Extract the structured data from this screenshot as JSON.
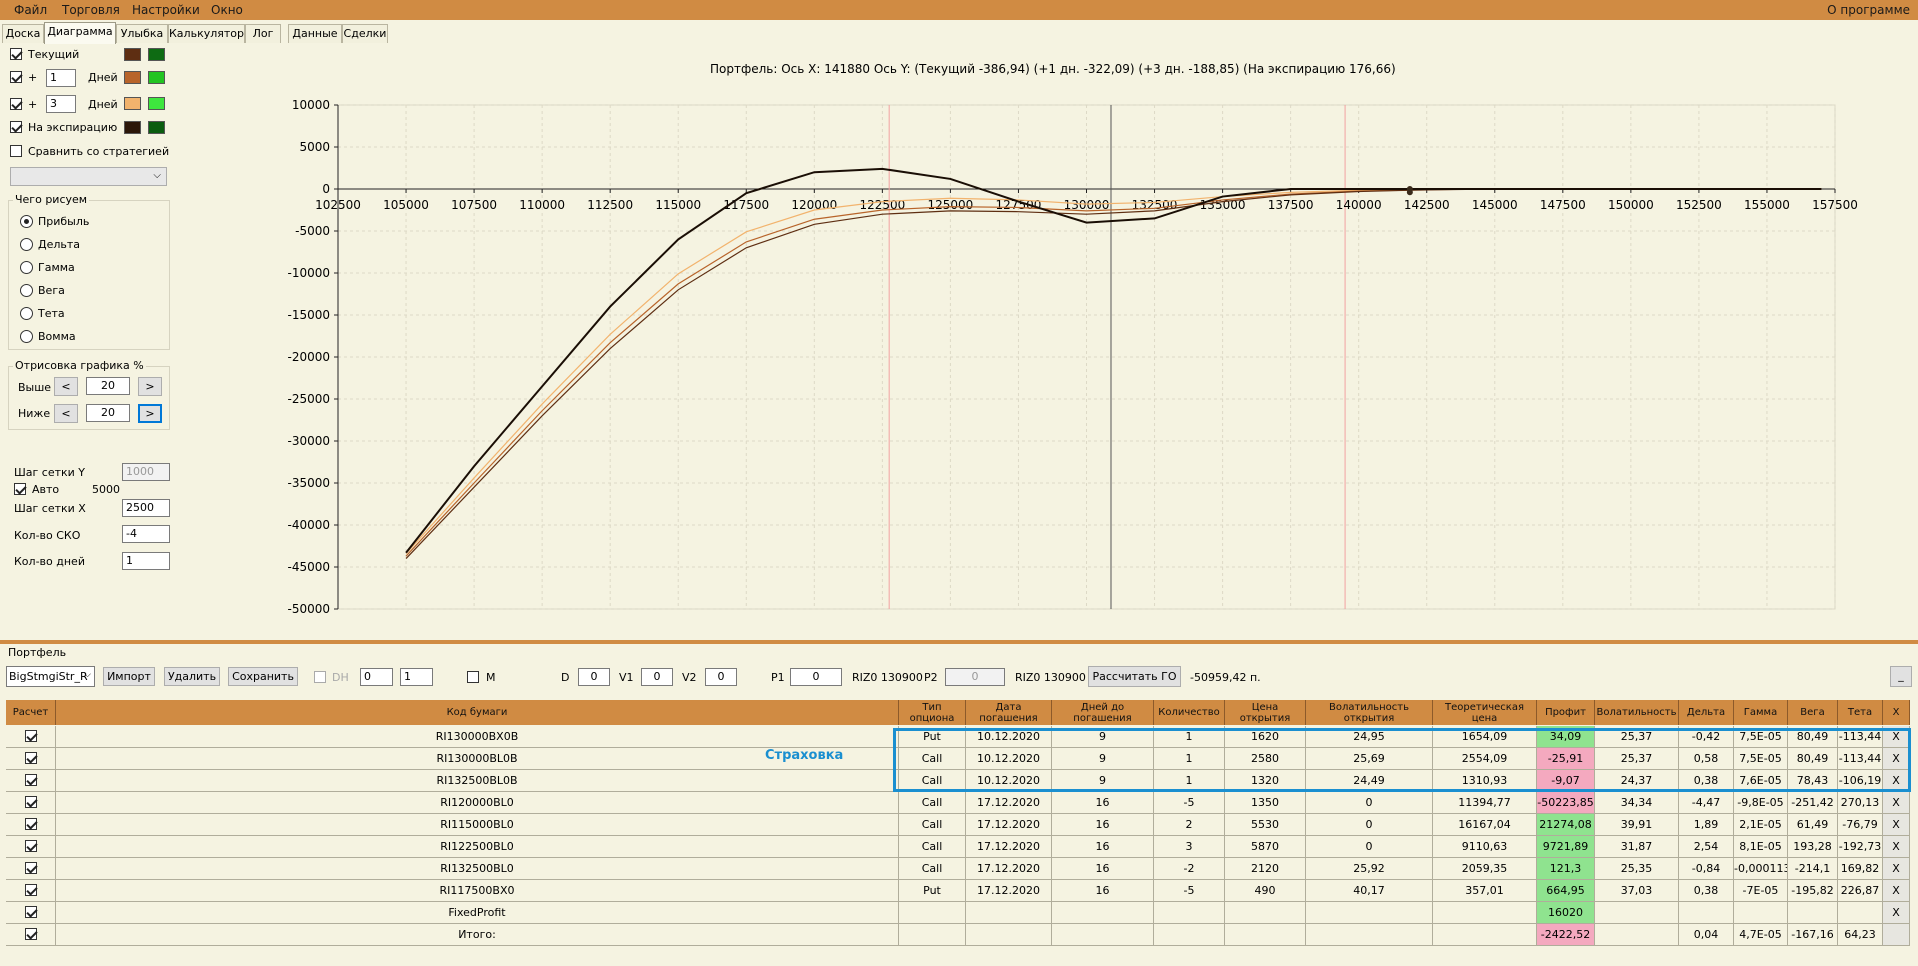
{
  "menu": {
    "file": "Файл",
    "trade": "Торговля",
    "settings": "Настройки",
    "window": "Окно",
    "about": "О программе"
  },
  "tabs": [
    "Доска",
    "Диаграмма",
    "Улыбка",
    "Калькулятор",
    "Лог",
    "Данные",
    "Сделки"
  ],
  "left_panel": {
    "current": "Текущий",
    "plus": "+",
    "days1": "1",
    "days2": "3",
    "days_label": "Дней",
    "expiry": "На экспирацию",
    "compare": "Сравнить со стратегией",
    "what_group": "Чего рисуем",
    "radios": [
      "Прибыль",
      "Дельта",
      "Гамма",
      "Вега",
      "Тета",
      "Вомма"
    ],
    "draw_group": "Отрисовка графика %",
    "above": "Выше",
    "below": "Ниже",
    "above_val": "20",
    "below_val": "20",
    "lt": "<",
    "gt": ">",
    "grid_y": "Шаг сетки Y",
    "grid_y_val": "1000",
    "auto": "Авто",
    "auto_val": "5000",
    "grid_x": "Шаг сетки X",
    "grid_x_val": "2500",
    "sko": "Кол-во СКО",
    "sko_val": "-4",
    "ndays": "Кол-во дней",
    "ndays_val": "1"
  },
  "colors": {
    "current": [
      "#5e2e12",
      "#0e6b13"
    ],
    "d1": [
      "#b8642a",
      "#22c422"
    ],
    "d3": [
      "#f2b36d",
      "#3ee63e"
    ],
    "expiry": [
      "#2b1608",
      "#0a5c0f"
    ]
  },
  "chart_title": "Портфель: Ось X:  141880 Ось Y:   (Текущий -386,94)  (+1 дн. -322,09)  (+3 дн. -188,85)  (На экспирацию 176,66)",
  "chart_data": {
    "type": "line",
    "xlim": [
      102500,
      157500
    ],
    "ylim": [
      -50000,
      10000
    ],
    "xticks": [
      "102500",
      "105000",
      "107500",
      "110000",
      "112500",
      "115000",
      "117500",
      "120000",
      "122500",
      "125000",
      "127500",
      "130000",
      "132500",
      "135000",
      "137500",
      "140000",
      "142500",
      "145000",
      "147500",
      "150000",
      "152500",
      "155000",
      "157500"
    ],
    "yticks": [
      "10000",
      "5000",
      "0",
      "-5000",
      "-10000",
      "-15000",
      "-20000",
      "-25000",
      "-30000",
      "-35000",
      "-40000",
      "-45000",
      "-50000"
    ],
    "vlines_red": [
      122750,
      139500
    ],
    "vline_gray": 130900,
    "series": [
      {
        "color": "#1a0e05",
        "x": [
          105000,
          107500,
          110000,
          112500,
          115000,
          117500,
          120000,
          122500,
          125000,
          127500,
          130000,
          132500,
          135000,
          137500,
          140000,
          142500,
          145000,
          147500,
          150000,
          155000,
          157000
        ],
        "y": [
          -43300,
          -33000,
          -23500,
          -14000,
          -6000,
          -500,
          2000,
          2400,
          1200,
          -1500,
          -4000,
          -3500,
          -900,
          0,
          0,
          0,
          0,
          0,
          0,
          0,
          0
        ]
      },
      {
        "color": "#5e2e12",
        "x": [
          105000,
          107500,
          110000,
          112500,
          115000,
          117500,
          120000,
          122500,
          125000,
          127500,
          130000,
          132500,
          135000,
          137500,
          140000,
          142500,
          145000,
          147500,
          150000,
          155000,
          157000
        ],
        "y": [
          -44000,
          -35500,
          -27000,
          -19000,
          -12000,
          -7000,
          -4200,
          -3000,
          -2600,
          -2700,
          -3000,
          -2600,
          -1500,
          -700,
          -300,
          -100,
          0,
          0,
          0,
          0,
          0
        ]
      },
      {
        "color": "#b8642a",
        "x": [
          105000,
          107500,
          110000,
          112500,
          115000,
          117500,
          120000,
          122500,
          125000,
          127500,
          130000,
          132500,
          135000,
          137500,
          140000,
          142500,
          145000,
          147500,
          150000,
          155000,
          157000
        ],
        "y": [
          -43700,
          -35000,
          -26400,
          -18300,
          -11300,
          -6300,
          -3600,
          -2500,
          -2100,
          -2200,
          -2600,
          -2300,
          -1300,
          -600,
          -250,
          -80,
          0,
          0,
          0,
          0,
          0
        ]
      },
      {
        "color": "#f2b36d",
        "x": [
          105000,
          107500,
          110000,
          112500,
          115000,
          117500,
          120000,
          122500,
          125000,
          127500,
          130000,
          132500,
          135000,
          137500,
          140000,
          142500,
          145000,
          147500,
          150000,
          155000,
          157000
        ],
        "y": [
          -43400,
          -34400,
          -25600,
          -17300,
          -10100,
          -5100,
          -2500,
          -1500,
          -1100,
          -1300,
          -1800,
          -1600,
          -900,
          -400,
          -150,
          -50,
          0,
          0,
          0,
          0,
          0
        ]
      }
    ]
  },
  "portfolio": {
    "label": "Портфель",
    "strategy": "BigStmgiStr_R",
    "import": "Импорт",
    "delete": "Удалить",
    "save": "Сохранить",
    "dh": "DH",
    "dh1": "0",
    "dh2": "1",
    "m": "M",
    "d": "D",
    "d_val": "0",
    "v1": "V1",
    "v1_val": "0",
    "v2": "V2",
    "v2_val": "0",
    "p1": "P1",
    "p1_val": "0",
    "riz1": "RIZ0 130900",
    "p2": "P2",
    "p2_val": "0",
    "riz2": "RIZ0 130900",
    "calc_go": "Рассчитать ГО",
    "go_val": "-50959,42 п.",
    "minimize": "_",
    "insurance": "Страховка"
  },
  "table": {
    "headers": [
      "Расчет",
      "Код бумаги",
      "Тип опциона",
      "Дата погашения",
      "Дней до погашения",
      "Количество",
      "Цена открытия",
      "Волатильность открытия",
      "Теоретическая цена",
      "Профит",
      "Волатильность",
      "Дельта",
      "Гамма",
      "Вега",
      "Тета",
      "X"
    ],
    "rows": [
      [
        "RI130000BX0B",
        "Put",
        "10.12.2020",
        "9",
        "1",
        "1620",
        "24,95",
        "1654,09",
        "34,09",
        "25,37",
        "-0,42",
        "7,5E-05",
        "80,49",
        "-113,44",
        "X"
      ],
      [
        "RI130000BL0B",
        "Call",
        "10.12.2020",
        "9",
        "1",
        "2580",
        "25,69",
        "2554,09",
        "-25,91",
        "25,37",
        "0,58",
        "7,5E-05",
        "80,49",
        "-113,44",
        "X"
      ],
      [
        "RI132500BL0B",
        "Call",
        "10.12.2020",
        "9",
        "1",
        "1320",
        "24,49",
        "1310,93",
        "-9,07",
        "24,37",
        "0,38",
        "7,6E-05",
        "78,43",
        "-106,19",
        "X"
      ],
      [
        "RI120000BL0",
        "Call",
        "17.12.2020",
        "16",
        "-5",
        "1350",
        "0",
        "11394,77",
        "-50223,85",
        "34,34",
        "-4,47",
        "-9,8E-05",
        "-251,42",
        "270,13",
        "X"
      ],
      [
        "RI115000BL0",
        "Call",
        "17.12.2020",
        "16",
        "2",
        "5530",
        "0",
        "16167,04",
        "21274,08",
        "39,91",
        "1,89",
        "2,1E-05",
        "61,49",
        "-76,79",
        "X"
      ],
      [
        "RI122500BL0",
        "Call",
        "17.12.2020",
        "16",
        "3",
        "5870",
        "0",
        "9110,63",
        "9721,89",
        "31,87",
        "2,54",
        "8,1E-05",
        "193,28",
        "-192,73",
        "X"
      ],
      [
        "RI132500BL0",
        "Call",
        "17.12.2020",
        "16",
        "-2",
        "2120",
        "25,92",
        "2059,35",
        "121,3",
        "25,35",
        "-0,84",
        "-0,000113",
        "-214,1",
        "169,82",
        "X"
      ],
      [
        "RI117500BX0",
        "Put",
        "17.12.2020",
        "16",
        "-5",
        "490",
        "40,17",
        "357,01",
        "664,95",
        "37,03",
        "0,38",
        "-7E-05",
        "-195,82",
        "226,87",
        "X"
      ],
      [
        "FixedProfit",
        "",
        "",
        "",
        "",
        "",
        "",
        "",
        "16020",
        "",
        "",
        "",
        "",
        "",
        "X"
      ],
      [
        "Итого:",
        "",
        "",
        "",
        "",
        "",
        "",
        "",
        "-2422,52",
        "",
        "0,04",
        "4,7E-05",
        "-167,16",
        "64,23",
        ""
      ]
    ],
    "profit_colors": [
      "green",
      "pink",
      "pink",
      "pink",
      "green",
      "green",
      "green",
      "green",
      "green",
      "pink"
    ]
  }
}
